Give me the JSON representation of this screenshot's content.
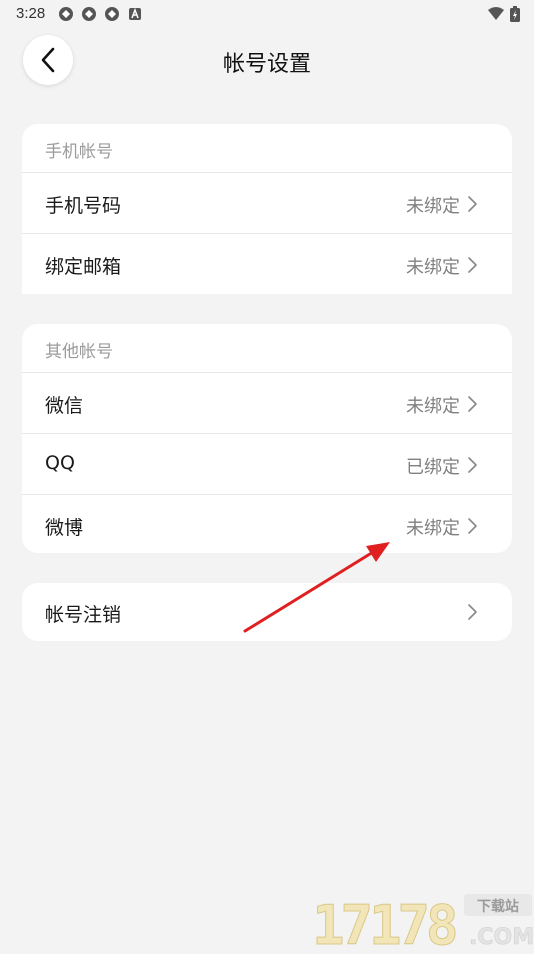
{
  "status_bar": {
    "time": "3:28"
  },
  "header": {
    "title": "帐号设置"
  },
  "phone_section": {
    "label": "手机帐号",
    "rows": [
      {
        "label": "手机号码",
        "value": "未绑定"
      },
      {
        "label": "绑定邮箱",
        "value": "未绑定"
      }
    ]
  },
  "other_section": {
    "label": "其他帐号",
    "rows": [
      {
        "label": "微信",
        "value": "未绑定"
      },
      {
        "label": "QQ",
        "value": "已绑定"
      },
      {
        "label": "微博",
        "value": "未绑定"
      }
    ]
  },
  "cancel_section": {
    "label": "帐号注销"
  },
  "watermark": {
    "number": "17178",
    "tag": "下载站",
    "domain": ".COM"
  },
  "colors": {
    "annotation_arrow": "#e02020",
    "background": "#f3f3f3",
    "card": "#ffffff"
  }
}
